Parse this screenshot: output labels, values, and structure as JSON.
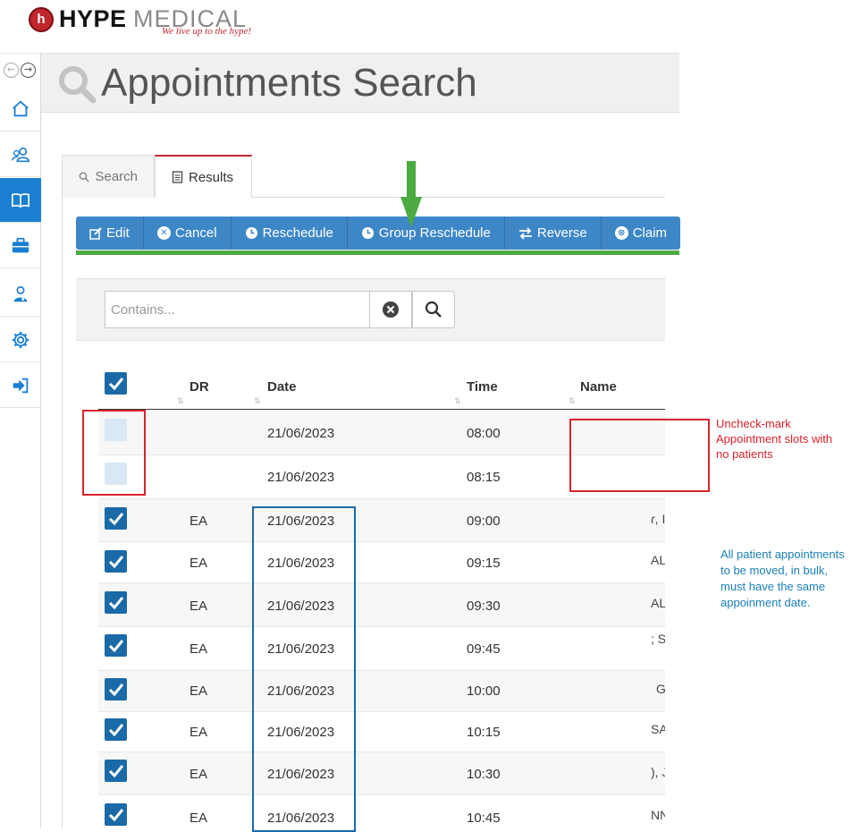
{
  "header": {
    "logo_badge": "h",
    "brand_bold": "HYPE",
    "brand_light": "MEDICAL",
    "tagline": "We live up to the hype!"
  },
  "page": {
    "title": "Appointments Search"
  },
  "tabs": [
    {
      "label": "Search",
      "icon": "search-icon"
    },
    {
      "label": "Results",
      "icon": "document-icon",
      "active": true
    }
  ],
  "toolbar": {
    "buttons": [
      {
        "label": "Edit",
        "icon": "edit-icon"
      },
      {
        "label": "Cancel",
        "icon": "cancel-icon"
      },
      {
        "label": "Reschedule",
        "icon": "clock-icon"
      },
      {
        "label": "Group Reschedule",
        "icon": "clock-icon"
      },
      {
        "label": "Reverse",
        "icon": "swap-icon"
      },
      {
        "label": "Claim",
        "icon": "claim-icon"
      }
    ]
  },
  "search": {
    "placeholder": "Contains...",
    "value": ""
  },
  "table": {
    "headers": {
      "dr": "DR",
      "date": "Date",
      "time": "Time",
      "name": "Name"
    },
    "rows": [
      {
        "checked": false,
        "dr": "",
        "date": "21/06/2023",
        "time": "08:00",
        "name": ""
      },
      {
        "checked": false,
        "dr": "",
        "date": "21/06/2023",
        "time": "08:15",
        "name": ""
      },
      {
        "checked": true,
        "dr": "EA",
        "date": "21/06/2023",
        "time": "09:00",
        "name": "ɾ, IAI"
      },
      {
        "checked": true,
        "dr": "EA",
        "date": "21/06/2023",
        "time": "09:15",
        "name": "AL L"
      },
      {
        "checked": true,
        "dr": "EA",
        "date": "21/06/2023",
        "time": "09:30",
        "name": "AL RA"
      },
      {
        "checked": true,
        "dr": "EA",
        "date": "21/06/2023",
        "time": "09:45",
        "name": "; STE"
      },
      {
        "checked": true,
        "dr": "EA",
        "date": "21/06/2023",
        "time": "10:00",
        "name": "GAE"
      },
      {
        "checked": true,
        "dr": "EA",
        "date": "21/06/2023",
        "time": "10:15",
        "name": "SAI A"
      },
      {
        "checked": true,
        "dr": "EA",
        "date": "21/06/2023",
        "time": "10:30",
        "name": "), JILL"
      },
      {
        "checked": true,
        "dr": "EA",
        "date": "21/06/2023",
        "time": "10:45",
        "name": "NNIF"
      }
    ]
  },
  "annotations": {
    "red_note": "Uncheck-mark Appointment slots with no patients",
    "blue_note": "All patient appointments to be moved, in bulk, must have the same appoinment date."
  },
  "colors": {
    "accent": "#1a7fd1",
    "toolbar": "#3d87c7",
    "brand_red": "#c0272d",
    "annotation_red": "#d9232d",
    "annotation_blue": "#1a6aa8",
    "arrow_green": "#4caa42"
  }
}
